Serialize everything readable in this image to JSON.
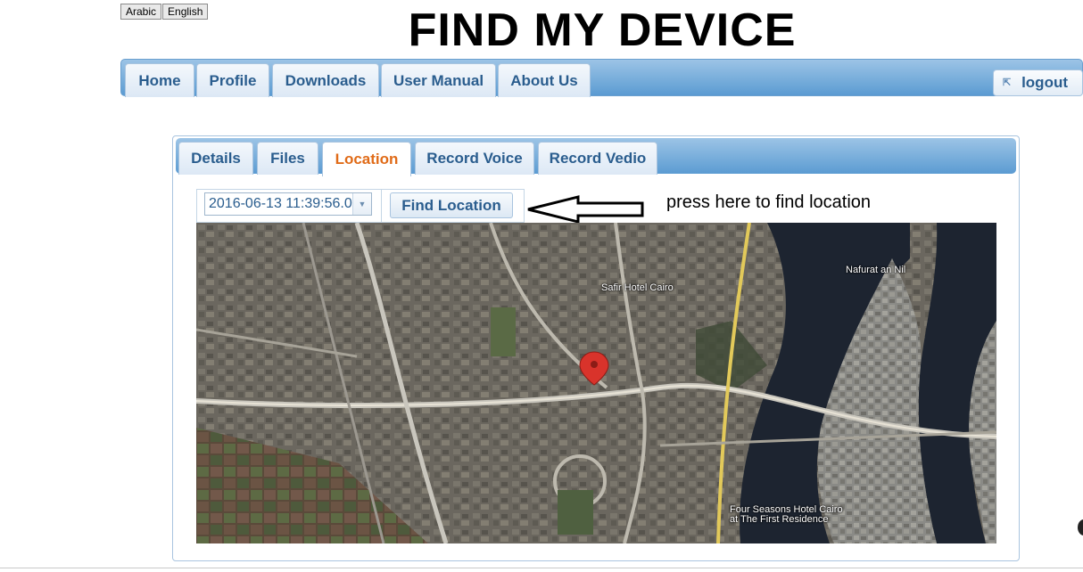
{
  "languages": [
    "Arabic",
    "English"
  ],
  "page_title": "FIND MY DEVICE",
  "nav": {
    "items": [
      "Home",
      "Profile",
      "Downloads",
      "User Manual",
      "About Us"
    ],
    "logout_label": "logout"
  },
  "tabs": {
    "items": [
      "Details",
      "Files",
      "Location",
      "Record Voice",
      "Record Vedio"
    ],
    "active": "Location"
  },
  "location": {
    "date_value": "2016-06-13 11:39:56.0",
    "find_button": "Find Location",
    "hint": "press here to find location"
  },
  "map": {
    "labels": [
      "Safir Hotel Cairo",
      "Nafurat an Nil",
      "Four Seasons Hotel Cairo",
      "at The First Residence"
    ]
  },
  "colors": {
    "accent_blue": "#2a5d8e",
    "active_tab": "#e06b18",
    "nav_bar": "#5b9bd2",
    "map_pin": "#d9332b"
  }
}
